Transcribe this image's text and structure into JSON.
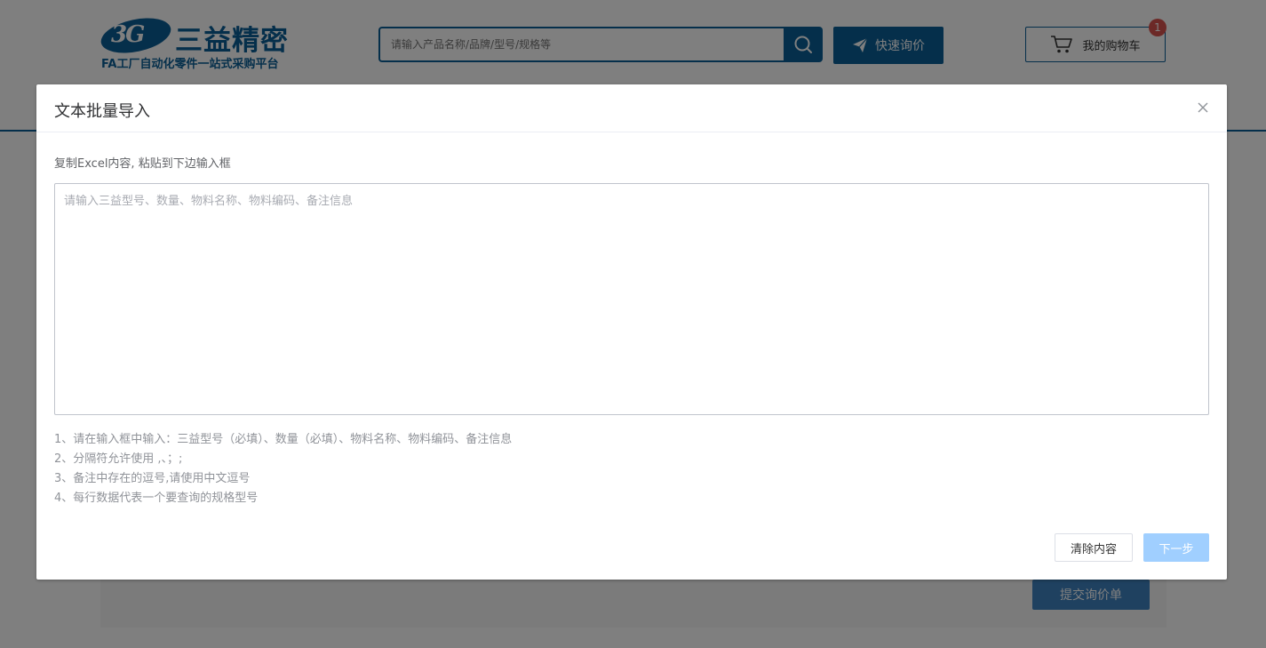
{
  "header": {
    "logo": {
      "badge_text": "3G",
      "name": "三益精密",
      "slogan": "FA工厂自动化零件一站式采购平台"
    },
    "search": {
      "placeholder": "请输入产品名称/品牌/型号/规格等"
    },
    "quick_inquiry_label": "快速询价",
    "cart": {
      "label": "我的购物车",
      "count": "1"
    }
  },
  "background": {
    "submit_quote_label": "提交询价单"
  },
  "dialog": {
    "title": "文本批量导入",
    "instruction": "复制Excel内容, 粘贴到下边输入框",
    "textarea": {
      "placeholder": "请输入三益型号、数量、物料名称、物料编码、备注信息",
      "value": ""
    },
    "tips": [
      "1、请在输入框中输入：三益型号（必填）、数量（必填）、物料名称、物料编码、备注信息",
      "2、分隔符允许使用 ,、；;",
      "3、备注中存在的逗号,请使用中文逗号",
      "4、每行数据代表一个要查询的规格型号"
    ],
    "clear_label": "清除内容",
    "next_label": "下一步"
  },
  "colors": {
    "brand": "#0b5f97",
    "next_disabled": "#a0cfff",
    "badge": "#d9534f"
  }
}
